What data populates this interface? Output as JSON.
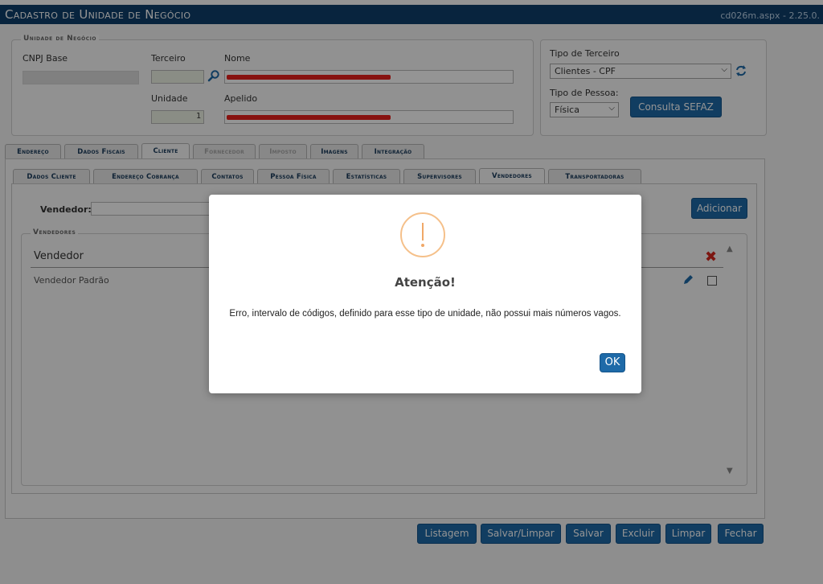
{
  "header": {
    "title": "Cadastro de Unidade de Negócio",
    "version": "cd026m.aspx - 2.25.0."
  },
  "unidade": {
    "legend": "Unidade de Negócio",
    "cnpj_label": "CNPJ Base",
    "terceiro_label": "Terceiro",
    "nome_label": "Nome",
    "unidade_label": "Unidade",
    "unidade_value": "1",
    "apelido_label": "Apelido"
  },
  "tipo": {
    "terceiro_label": "Tipo de Terceiro",
    "terceiro_value": "Clientes - CPF",
    "pessoa_label": "Tipo de Pessoa:",
    "pessoa_value": "Física",
    "sefaz_button": "Consulta SEFAZ"
  },
  "main_tabs": [
    {
      "label": "Endereço",
      "state": "normal"
    },
    {
      "label": "Dados Fiscais",
      "state": "normal"
    },
    {
      "label": "Cliente",
      "state": "active"
    },
    {
      "label": "Fornecedor",
      "state": "disabled"
    },
    {
      "label": "Imposto",
      "state": "disabled"
    },
    {
      "label": "Imagens",
      "state": "normal"
    },
    {
      "label": "Integração",
      "state": "normal"
    }
  ],
  "sub_tabs": [
    {
      "label": "Dados Cliente",
      "state": "normal"
    },
    {
      "label": "Endereço Cobrança",
      "state": "normal"
    },
    {
      "label": "Contatos",
      "state": "normal"
    },
    {
      "label": "Pessoa Física",
      "state": "normal"
    },
    {
      "label": "Estatísticas",
      "state": "normal"
    },
    {
      "label": "Supervisores",
      "state": "normal"
    },
    {
      "label": "Vendedores",
      "state": "active"
    },
    {
      "label": "Transportadoras",
      "state": "normal"
    }
  ],
  "vendedores": {
    "field_label": "Vendedor:",
    "add_button": "Adicionar",
    "legend": "Vendedores",
    "column_header": "Vendedor",
    "rows": [
      {
        "name": "Vendedor Padrão"
      }
    ]
  },
  "footer_buttons": [
    "Listagem",
    "Salvar/Limpar",
    "Salvar",
    "Excluir",
    "Limpar",
    "Fechar"
  ],
  "dialog": {
    "title": "Atenção!",
    "message": "Erro, intervalo de códigos, definido para esse tipo de unidade, não possui mais números vagos.",
    "ok_button": "OK",
    "icon": "warning-icon"
  },
  "colors": {
    "header_bg": "#0f3f6b",
    "button_bg": "#1e6aa8",
    "warning": "#f0a868",
    "delete": "#d6261e"
  }
}
